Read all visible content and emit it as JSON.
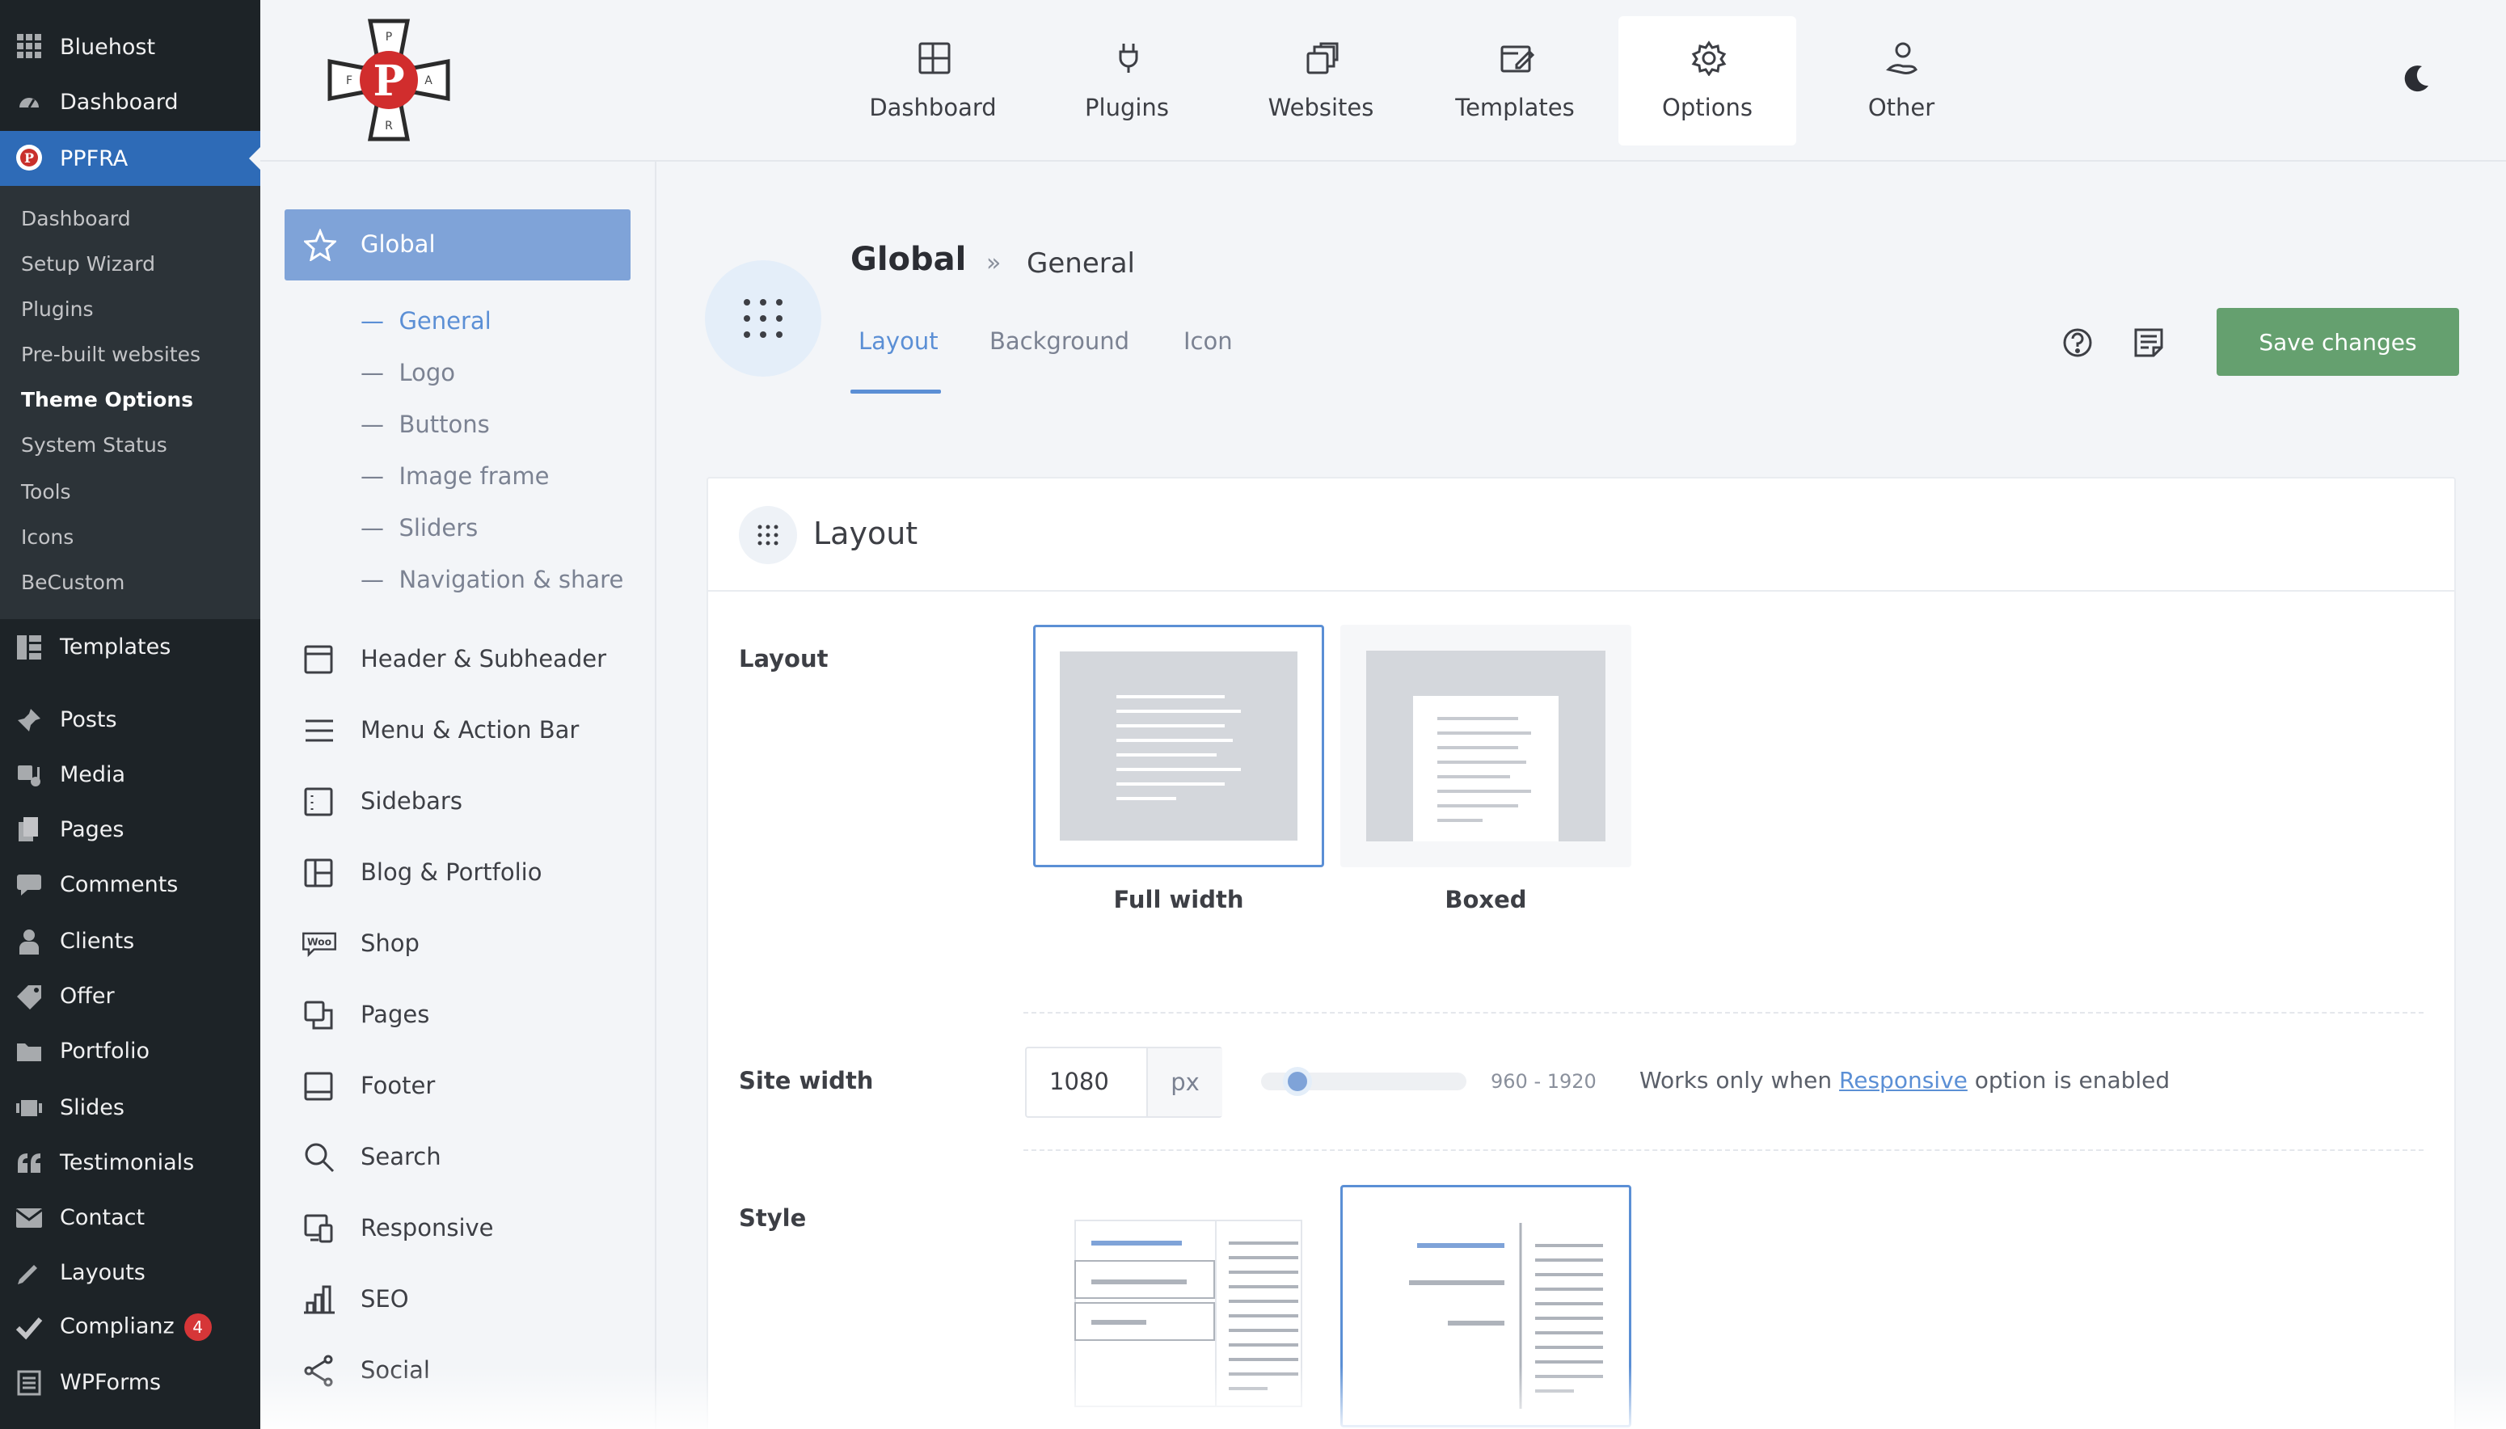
{
  "wp_menu": {
    "bluehost": "Bluehost",
    "dashboard": "Dashboard",
    "ppfra": "PPFRA",
    "submenu": [
      "Dashboard",
      "Setup Wizard",
      "Plugins",
      "Pre-built websites",
      "Theme Options",
      "System Status",
      "Tools",
      "Icons",
      "BeCustom"
    ],
    "templates": "Templates",
    "posts": "Posts",
    "media": "Media",
    "pages": "Pages",
    "comments": "Comments",
    "clients": "Clients",
    "offer": "Offer",
    "portfolio": "Portfolio",
    "slides": "Slides",
    "testimonials": "Testimonials",
    "contact": "Contact",
    "layouts": "Layouts",
    "complianz": "Complianz",
    "complianz_badge": "4",
    "wpforms": "WPForms"
  },
  "logo": {
    "letter": "P",
    "ring_letters": [
      "P",
      "F",
      "R",
      "A"
    ]
  },
  "top_nav": {
    "items": [
      "Dashboard",
      "Plugins",
      "Websites",
      "Templates",
      "Options",
      "Other"
    ],
    "active": "Options"
  },
  "panel": {
    "global": "Global",
    "global_subitems": [
      "General",
      "Logo",
      "Buttons",
      "Image frame",
      "Sliders",
      "Navigation & share"
    ],
    "sections": [
      "Header & Subheader",
      "Menu & Action Bar",
      "Sidebars",
      "Blog & Portfolio",
      "Shop",
      "Pages",
      "Footer",
      "Search",
      "Responsive",
      "SEO",
      "Social"
    ],
    "shop_icon_text": "Woo"
  },
  "header": {
    "crumb_main": "Global",
    "crumb_sep": "»",
    "crumb_sub": "General",
    "tabs": [
      "Layout",
      "Background",
      "Icon"
    ],
    "active_tab": "Layout",
    "save_label": "Save changes"
  },
  "card": {
    "title": "Layout",
    "layout_label": "Layout",
    "layout_options": [
      "Full width",
      "Boxed"
    ],
    "layout_selected": "Full width",
    "site_width_label": "Site width",
    "site_width_value": "1080",
    "site_width_unit": "px",
    "site_width_slider_level": 0.125,
    "site_width_range": "960 - 1920",
    "note_prefix": "Works only when ",
    "note_link": "Responsive",
    "note_suffix": " option is enabled",
    "style_label": "Style",
    "style_selected_index": 1
  },
  "colors": {
    "accent": "#5b8fd5",
    "wp_active": "#2e6bb7",
    "save": "#65a06f",
    "badge": "#d63638"
  }
}
